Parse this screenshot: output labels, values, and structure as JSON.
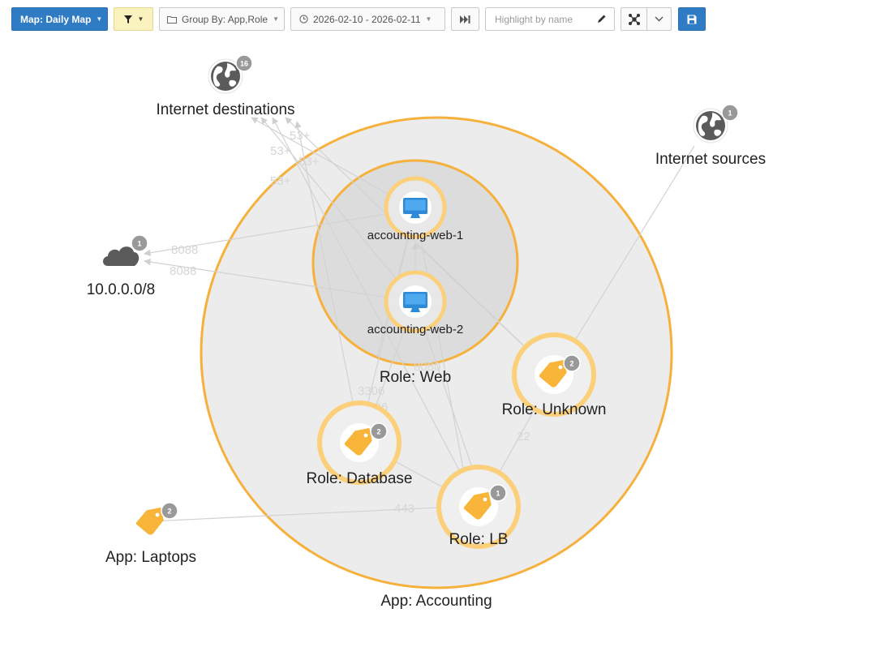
{
  "toolbar": {
    "map_label": "Map: Daily Map",
    "group_by_label": "Group By: App,Role",
    "date_range": "2026-02-10 - 2026-02-11",
    "search_placeholder": "Highlight by name"
  },
  "colors": {
    "primary": "#2f7bc4",
    "filter_bg": "#fbf3bf",
    "group_ring": "#f7b33b",
    "role_ring": "#fcd07a",
    "tag": "#f8b539",
    "badge": "#999999",
    "globe": "#5b5b5b",
    "monitor": "#2d8ad8"
  },
  "map": {
    "groups": {
      "app_accounting": "App: Accounting",
      "role_web": "Role: Web"
    },
    "nodes": {
      "internet_destinations": {
        "label": "Internet destinations",
        "badge": "16",
        "icon": "globe-icon"
      },
      "internet_sources": {
        "label": "Internet sources",
        "badge": "1",
        "icon": "globe-icon"
      },
      "network_10": {
        "label": "10.0.0.0/8",
        "badge": "1",
        "icon": "cloud-icon"
      },
      "web1": {
        "label": "accounting-web-1",
        "icon": "monitor-icon"
      },
      "web2": {
        "label": "accounting-web-2",
        "icon": "monitor-icon"
      },
      "role_unknown": {
        "label": "Role: Unknown",
        "badge": "2",
        "icon": "tag-icon"
      },
      "role_database": {
        "label": "Role: Database",
        "badge": "2",
        "icon": "tag-icon"
      },
      "role_lb": {
        "label": "Role: LB",
        "badge": "1",
        "icon": "tag-icon"
      },
      "app_laptops": {
        "label": "App: Laptops",
        "badge": "2",
        "icon": "tag-icon"
      }
    },
    "edge_labels": {
      "dest_a": "53+",
      "dest_b": "53+",
      "dest_c": "53+",
      "dest_d": "53+",
      "net_a": "8088",
      "net_b": "8088",
      "web_a": "8080",
      "web_b": "8080",
      "db_a": "3306",
      "db_b": "3306",
      "unknown_lb": "22",
      "laptops_lb": "443"
    }
  }
}
